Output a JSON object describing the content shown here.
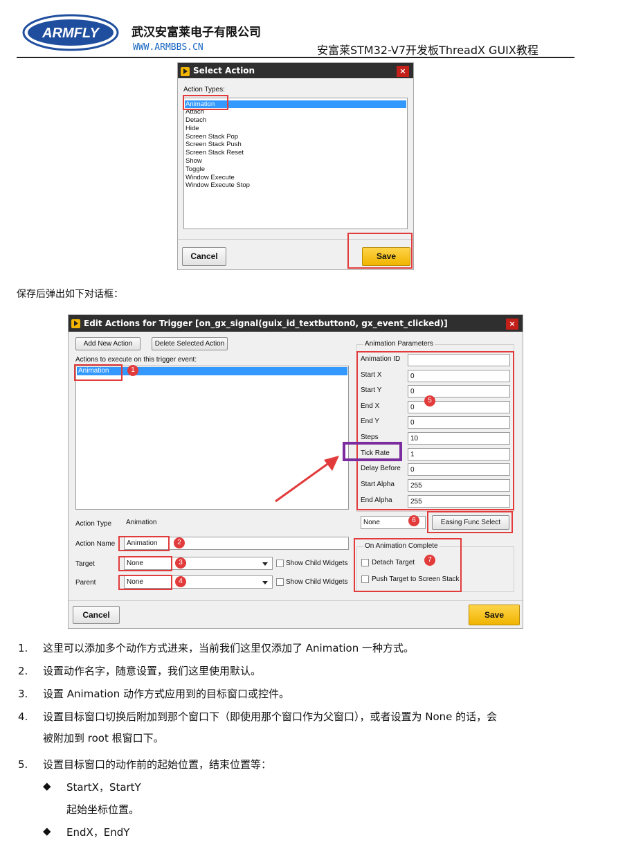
{
  "header": {
    "logo_text": "ARMFLY",
    "company_name": "武汉安富莱电子有限公司",
    "company_url": "WWW.ARMBBS.CN",
    "doc_title": "安富莱STM32-V7开发板ThreadX GUIX教程"
  },
  "select_action_dialog": {
    "title": "Select Action",
    "close_label": "×",
    "list_label": "Action Types:",
    "items": [
      "Animation",
      "Attach",
      "Detach",
      "Hide",
      "Screen Stack Pop",
      "Screen Stack Push",
      "Screen Stack Reset",
      "Show",
      "Toggle",
      "Window Execute",
      "Window Execute Stop"
    ],
    "selected_item": "Animation",
    "cancel_label": "Cancel",
    "save_label": "Save"
  },
  "caption": "保存后弹出如下对话框：",
  "edit_actions_dialog": {
    "title": "Edit Actions for Trigger [on_gx_signal(guix_id_textbutton0, gx_event_clicked)]",
    "close_label": "×",
    "add_button": "Add New Action",
    "delete_button": "Delete Selected Action",
    "actions_label": "Actions to execute on this trigger event:",
    "actions": [
      "Animation"
    ],
    "action_type_label": "Action Type",
    "action_type_value": "Animation",
    "action_name_label": "Action Name",
    "action_name_value": "Animation",
    "target_label": "Target",
    "target_value": "None",
    "parent_label": "Parent",
    "parent_value": "None",
    "show_child_widgets": "Show Child Widgets",
    "anim_params_title": "Animation Parameters",
    "params": [
      {
        "label": "Animation ID",
        "value": ""
      },
      {
        "label": "Start X",
        "value": "0"
      },
      {
        "label": "Start Y",
        "value": "0"
      },
      {
        "label": "End X",
        "value": "0"
      },
      {
        "label": "End Y",
        "value": "0"
      },
      {
        "label": "Steps",
        "value": "10"
      },
      {
        "label": "Tick Rate",
        "value": "1"
      },
      {
        "label": "Delay Before",
        "value": "0"
      },
      {
        "label": "Start Alpha",
        "value": "255"
      },
      {
        "label": "End Alpha",
        "value": "255"
      }
    ],
    "easing_value": "None",
    "easing_button": "Easing Func Select",
    "on_complete_title": "On Animation Complete",
    "detach_target": "Detach Target",
    "push_target": "Push Target to Screen Stack",
    "cancel_label": "Cancel",
    "save_label": "Save",
    "badges": [
      "1",
      "2",
      "3",
      "4",
      "5",
      "6",
      "7"
    ]
  },
  "notes": [
    {
      "num": "1.",
      "lines": [
        "这里可以添加多个动作方式进来，当前我们这里仅添加了 Animation 一种方式。"
      ]
    },
    {
      "num": "2.",
      "lines": [
        "设置动作名字，随意设置，我们这里使用默认。"
      ]
    },
    {
      "num": "3.",
      "lines": [
        "设置 Animation 动作方式应用到的目标窗口或控件。"
      ]
    },
    {
      "num": "4.",
      "lines": [
        "设置目标窗口切换后附加到那个窗口下（即使用那个窗口作为父窗口），或者设置为 None 的话，会",
        "被附加到 root 根窗口下。"
      ]
    },
    {
      "num": "5.",
      "lines": [
        "设置目标窗口的动作前的起始位置，结束位置等："
      ]
    }
  ],
  "sub_bullets": [
    {
      "symbol": "◆",
      "title": "StartX，StartY",
      "desc": "起始坐标位置。"
    },
    {
      "symbol": "◆",
      "title": "EndX，EndY",
      "desc": ""
    }
  ],
  "colors": {
    "highlight_red": "#e23b3b",
    "highlight_purple": "#7b2c9e",
    "save_yellow": "#f0b400",
    "selection_blue": "#3399ff"
  }
}
